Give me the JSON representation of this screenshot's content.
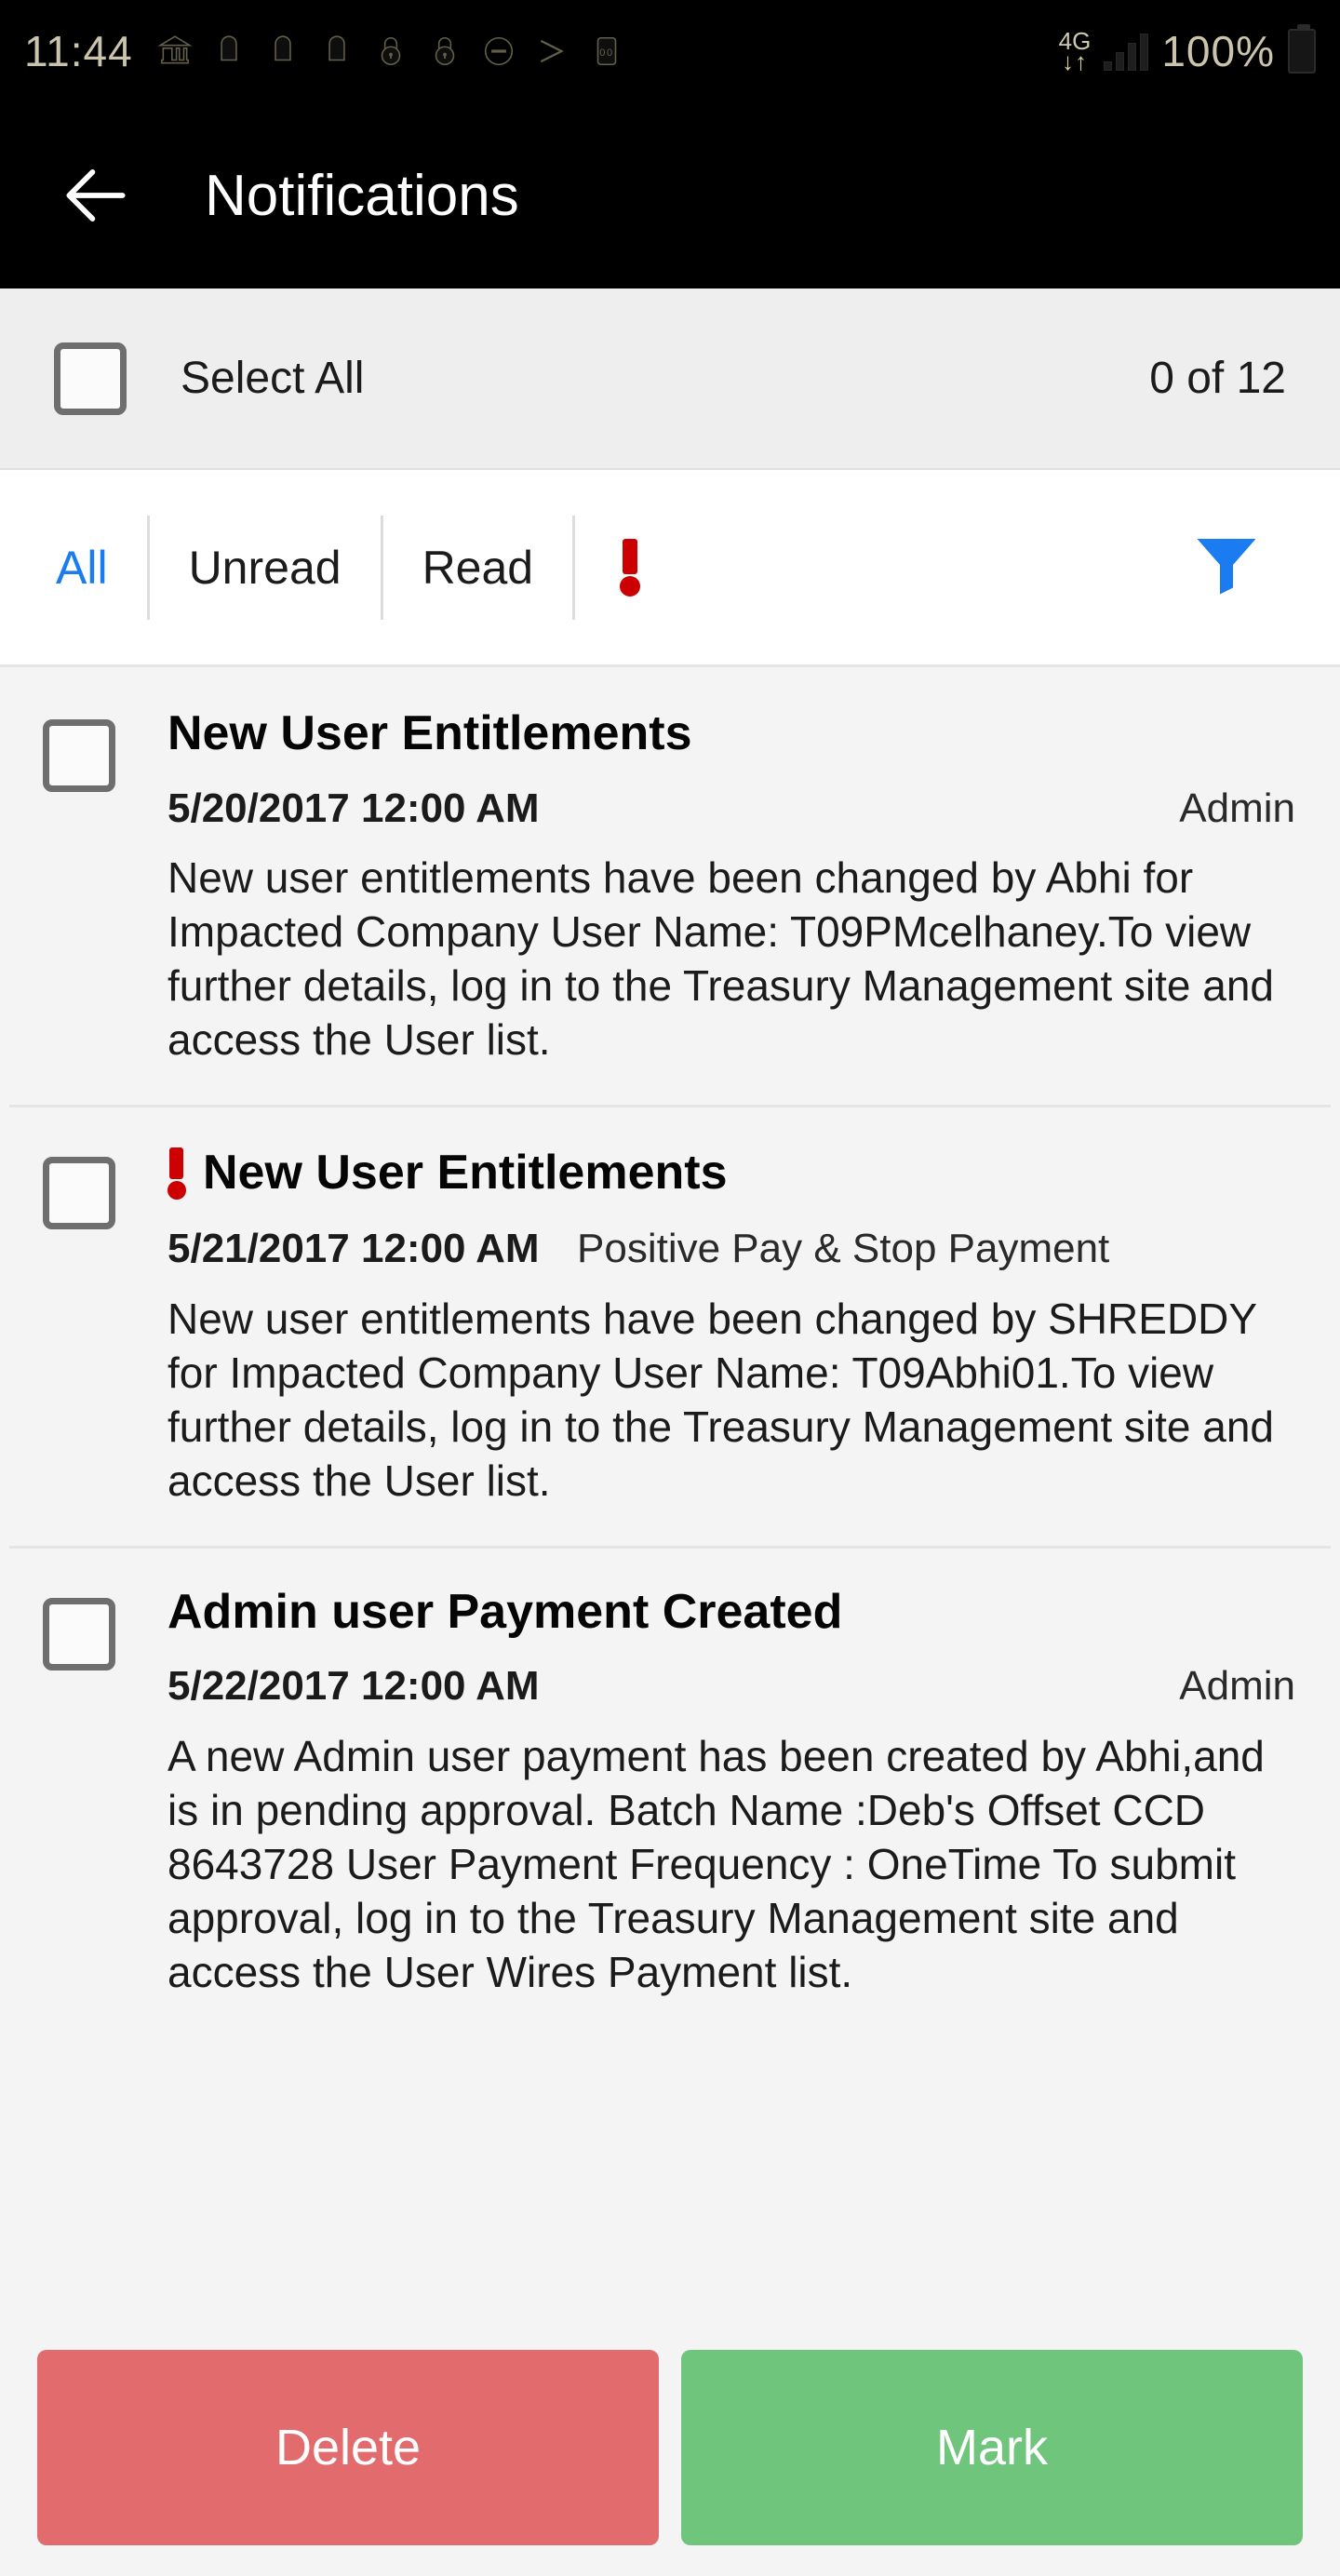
{
  "status_bar": {
    "clock": "11:44",
    "icons": [
      "bank-icon",
      "notification-icon",
      "notification-icon",
      "notification-icon",
      "lock-icon",
      "lock-icon",
      "do-not-disturb-icon",
      "send-icon",
      "sim-icon"
    ],
    "network_label": "4G",
    "network_arrows": "↓↑",
    "battery_percent": "100%"
  },
  "app_bar": {
    "back_icon": "back-arrow-icon",
    "title": "Notifications"
  },
  "select_bar": {
    "checkbox_checked": false,
    "label": "Select All",
    "count": "0 of 12"
  },
  "tabs": {
    "items": [
      {
        "label": "All",
        "active": true
      },
      {
        "label": "Unread",
        "active": false
      },
      {
        "label": "Read",
        "active": false
      }
    ],
    "alert_icon": "exclamation-icon",
    "filter_icon": "filter-funnel-icon",
    "accent_blue": "#1a7cf0",
    "alert_red": "#cc0000"
  },
  "notifications": [
    {
      "priority": false,
      "title": "New User Entitlements",
      "date": "5/20/2017 12:00 AM",
      "source": "Admin",
      "source_align": "right",
      "body": "New user entitlements have been changed by Abhi for Impacted Company User Name: T09PMcelhaney.To view further details, log in to the Treasury Management site and access the User list."
    },
    {
      "priority": true,
      "title": "New User Entitlements",
      "date": "5/21/2017 12:00 AM",
      "source": "Positive Pay & Stop Payment",
      "source_align": "left",
      "body": "New user entitlements have been changed by SHREDDY for Impacted Company User Name: T09Abhi01.To view further details, log in to the Treasury Management site and access the User list."
    },
    {
      "priority": false,
      "title": "Admin user Payment Created",
      "date": "5/22/2017 12:00 AM",
      "source": "Admin",
      "source_align": "right",
      "body": "A new Admin user payment has been created by Abhi,and is in pending approval. Batch Name :Deb's Offset CCD 8643728 User Payment Frequency : OneTime To submit approval, log in to the Treasury Management site and access the User Wires Payment list."
    }
  ],
  "actions": {
    "delete_label": "Delete",
    "mark_label": "Mark",
    "delete_color": "#e26b6e",
    "mark_color": "#6fc57c"
  }
}
